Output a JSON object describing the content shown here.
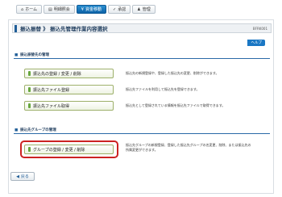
{
  "nav": {
    "tabs": [
      {
        "label": "ホーム",
        "icon": "home-icon",
        "glyph": "⌂",
        "active": false
      },
      {
        "label": "明細照会",
        "icon": "document-icon",
        "glyph": "▤",
        "active": false
      },
      {
        "label": "資金移動",
        "icon": "yen-icon",
        "glyph": "¥",
        "active": true
      },
      {
        "label": "承認",
        "icon": "check-icon",
        "glyph": "✓",
        "active": false
      },
      {
        "label": "管理",
        "icon": "person-icon",
        "glyph": "♟",
        "active": false
      }
    ]
  },
  "page": {
    "title": "振込振替 》 振込先管理作業内容選択",
    "code": "BFRK001",
    "help_label": "ヘルプ"
  },
  "sections": {
    "payee_mgmt": {
      "label": "振込振替先の管理",
      "items": [
        {
          "label": "振込先の登録 / 変更 / 削除",
          "desc": "振込先の新規登録や、登録した振込先の変更、削除ができます。"
        },
        {
          "label": "振込先ファイル登録",
          "desc": "振込先ファイルを利用して振込先を登録できます。"
        },
        {
          "label": "振込先ファイル取得",
          "desc": "振込先として登録されている情報を振込先ファイルで取得できます。"
        }
      ]
    },
    "group_mgmt": {
      "label": "振込先グループの管理",
      "button_label": "グループの登録 / 変更 / 削除",
      "desc_line1": "振込先グループの新規登録、登録した振込先グループの名変更、削除、または振込先の",
      "desc_line2": "所属変更ができます。"
    }
  },
  "back_label": "戻る",
  "colors": {
    "accent_blue": "#1f5d97",
    "button_bar_green": "#68a73e",
    "highlight_red": "#cc2222"
  }
}
